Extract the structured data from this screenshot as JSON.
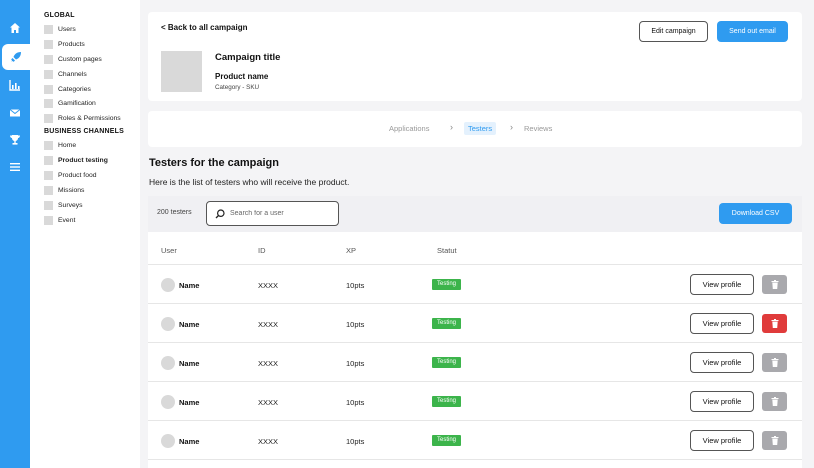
{
  "rail": {
    "icons": [
      "home-icon",
      "rocket-icon",
      "chart-icon",
      "mail-icon",
      "trophy-icon",
      "menu-icon"
    ],
    "active": "rocket-icon",
    "accent_color": "#2f9bf0"
  },
  "sidebar": {
    "global_heading": "GLOBAL",
    "global_items": [
      "Users",
      "Products",
      "Custom pages",
      "Channels",
      "Categories",
      "Gamification",
      "Roles & Permissions"
    ],
    "business_heading": "BUSINESS CHANNELS",
    "business_items": [
      "Home",
      "Product testing",
      "Product food",
      "Missions",
      "Surveys",
      "Event"
    ],
    "active_item": "Product testing"
  },
  "header": {
    "back_label": "< Back to all campaign",
    "edit_label": "Edit campaign",
    "send_label": "Send out email",
    "campaign_title": "Campaign title",
    "product_name": "Product name",
    "product_category": "Category - SKU"
  },
  "steps": {
    "items": [
      "Applications",
      "Testers",
      "Reviews"
    ],
    "active": "Testers"
  },
  "section": {
    "title": "Testers for the campaign",
    "subtitle": "Here is the list of testers who will receive the product."
  },
  "toolbar": {
    "count_label": "200 testers",
    "search_placeholder": "Search for a user",
    "download_label": "Download CSV"
  },
  "table": {
    "columns": [
      "User",
      "ID",
      "XP",
      "Statut"
    ],
    "view_label": "View profile",
    "rows": [
      {
        "name": "Name",
        "id": "XXXX",
        "xp": "10pts",
        "status": "Testing",
        "delete_state": "default"
      },
      {
        "name": "Name",
        "id": "XXXX",
        "xp": "10pts",
        "status": "Testing",
        "delete_state": "danger"
      },
      {
        "name": "Name",
        "id": "XXXX",
        "xp": "10pts",
        "status": "Testing",
        "delete_state": "default"
      },
      {
        "name": "Name",
        "id": "XXXX",
        "xp": "10pts",
        "status": "Testing",
        "delete_state": "default"
      },
      {
        "name": "Name",
        "id": "XXXX",
        "xp": "10pts",
        "status": "Testing",
        "delete_state": "default"
      }
    ],
    "status_color": "#3cb44b",
    "danger_color": "#e03b3b"
  }
}
